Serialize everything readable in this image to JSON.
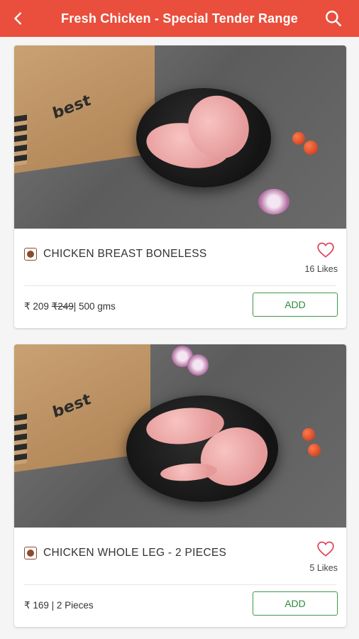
{
  "header": {
    "title": "Fresh Chicken - Special Tender Range",
    "back_icon": "chevron-left-icon",
    "search_icon": "search-icon"
  },
  "products": [
    {
      "name": "CHICKEN BREAST BONELESS",
      "likes": "16 Likes",
      "price": "₹ 209 ",
      "mrp": "₹249",
      "unit": "| 500 gms",
      "add_label": "ADD"
    },
    {
      "name": "CHICKEN WHOLE LEG - 2 PIECES",
      "likes": "5 Likes",
      "price": "₹ 169 ",
      "mrp": "",
      "unit": "| 2 Pieces",
      "add_label": "ADD"
    }
  ],
  "colors": {
    "header_bg": "#e94f3c",
    "add_border": "#3c9a46",
    "heart": "#e0435a",
    "nonveg_mark": "#8c4a2f"
  }
}
